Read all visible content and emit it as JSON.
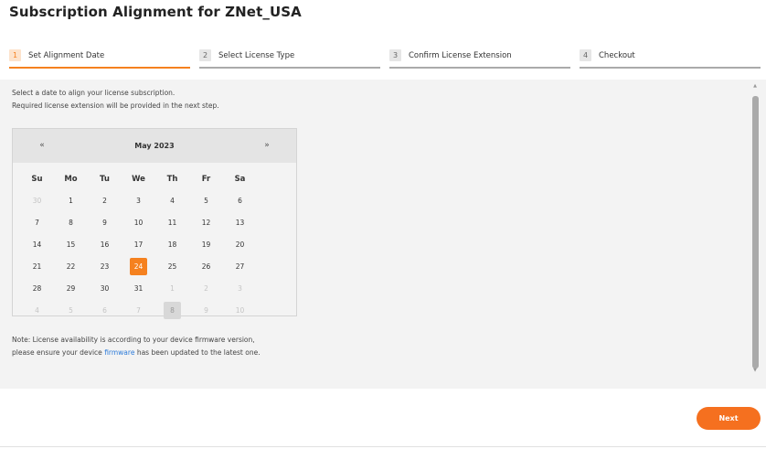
{
  "page": {
    "title": "Subscription Alignment for ZNet_USA"
  },
  "steps": [
    {
      "num": "1",
      "label": "Set Alignment Date"
    },
    {
      "num": "2",
      "label": "Select License Type"
    },
    {
      "num": "3",
      "label": "Confirm License Extension"
    },
    {
      "num": "4",
      "label": "Checkout"
    }
  ],
  "intro": {
    "line1": "Select a date to align your license subscription.",
    "line2": "Required license extension will be provided in the next step."
  },
  "calendar": {
    "prev": "«",
    "next": "»",
    "month": "May 2023",
    "weekdays": [
      "Su",
      "Mo",
      "Tu",
      "We",
      "Th",
      "Fr",
      "Sa"
    ],
    "weeks": [
      [
        "30",
        "1",
        "2",
        "3",
        "4",
        "5",
        "6"
      ],
      [
        "7",
        "8",
        "9",
        "10",
        "11",
        "12",
        "13"
      ],
      [
        "14",
        "15",
        "16",
        "17",
        "18",
        "19",
        "20"
      ],
      [
        "21",
        "22",
        "23",
        "24",
        "25",
        "26",
        "27"
      ],
      [
        "28",
        "29",
        "30",
        "31",
        "1",
        "2",
        "3"
      ],
      [
        "4",
        "5",
        "6",
        "7",
        "8",
        "9",
        "10"
      ]
    ],
    "selected_day": "24",
    "accent_color": "#f5811f"
  },
  "note": {
    "line1": "Note: License availability is according to your device firmware version,",
    "line2_before": "please ensure your device ",
    "line2_link": "firmware",
    "line2_after": " has been updated to the latest one."
  },
  "scroll": {
    "up": "▲",
    "down": "▼"
  },
  "footer": {
    "next_label": "Next"
  }
}
